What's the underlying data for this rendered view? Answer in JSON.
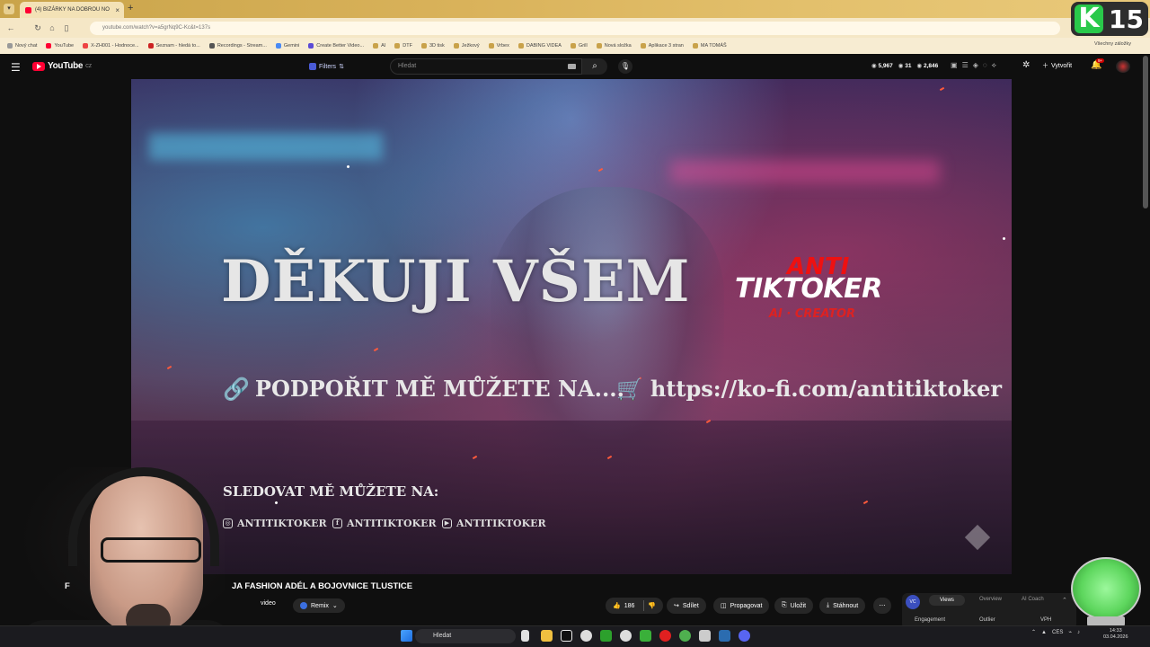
{
  "browser": {
    "tab_title": "(4) BIZÁRKY NA DOBROU NO",
    "url": "youtube.com/watch?v=a5grNq9C-Kc&t=137s",
    "bookmarks": [
      "Nový chat",
      "YouTube",
      "X-ZH001 - Hodnoce...",
      "Seznam - hledá to...",
      "Recordings - Stream...",
      "Gemini",
      "Create Better Video...",
      "AI",
      "DTF",
      "3D tisk",
      "Ježkový",
      "Vrbex",
      "DABING VIDEA",
      "Grill",
      "Nová složka",
      "Aplikace 3 stran",
      "MA TOMÁŠ"
    ],
    "all_bookmarks": "Všechny záložky"
  },
  "overlay": {
    "k_letter": "K",
    "number": "15"
  },
  "header": {
    "logo_text": "YouTube",
    "logo_sup": "CZ",
    "filters_label": "Filters",
    "search_placeholder": "Hledat",
    "stats": [
      "5,967",
      "31",
      "2,846"
    ],
    "create_label": "Vytvořit",
    "notif_count": "9+"
  },
  "video": {
    "title_main": "DĚKUJI VŠEM",
    "logo_anti": "ANTI",
    "logo_tiktoker": "TIKTOKER",
    "logo_sub": "AI · CREATOR",
    "support_text": "PODPOŘIT MĚ MŮŽETE NA....",
    "kofi_url": "https://ko-fi.com/antitiktoker",
    "follow_text": "SLEDOVAT MĚ MŮŽETE NA:",
    "social_handles": [
      "ANTITIKTOKER",
      "ANTITIKTOKER",
      "ANTITIKTOKER"
    ]
  },
  "below": {
    "title_prefix": "F",
    "title": "JA FASHION ADÉL A BOJOVNICE TLUSTICE",
    "video_btn": "video",
    "remix_label": "Remix",
    "like_count": "186",
    "share_label": "Sdílet",
    "promote_label": "Propagovat",
    "save_label": "Uložit",
    "download_label": "Stáhnout"
  },
  "analytics": {
    "logo": "VC",
    "tabs": [
      "Views",
      "Overview",
      "AI Coach"
    ],
    "sub": [
      "Engagement",
      "Outlier",
      "VPH"
    ]
  },
  "taskbar": {
    "search_placeholder": "Hledat",
    "lang": "CES",
    "time": "14:33",
    "date": "03.04.2026"
  },
  "colors": {
    "yt_red": "#ff0033",
    "kick_green": "#29c94a",
    "tab_gold": "#d9b25a"
  }
}
